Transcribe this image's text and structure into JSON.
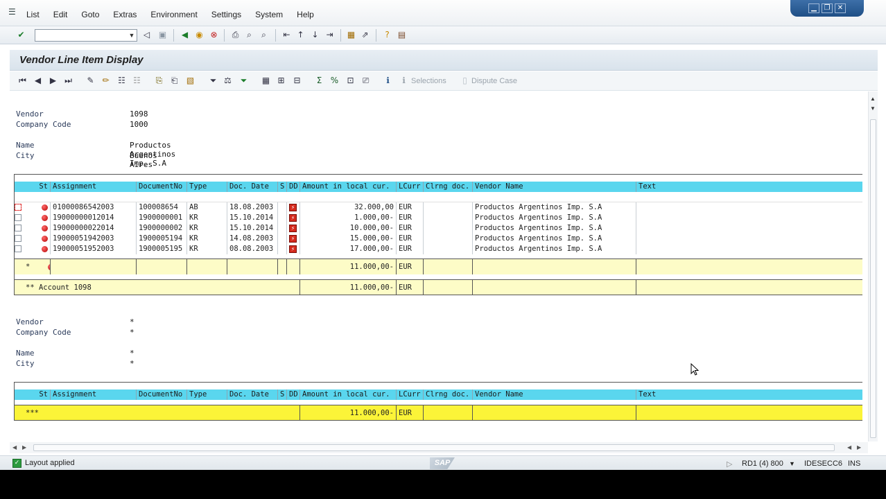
{
  "menu": [
    "List",
    "Edit",
    "Goto",
    "Extras",
    "Environment",
    "Settings",
    "System",
    "Help"
  ],
  "command_field": {
    "value": ""
  },
  "window_controls": {
    "minimize": "▁",
    "restore": "❐",
    "close": "✕"
  },
  "title": "Vendor Line Item Display",
  "app_toolbar": {
    "selections_label": "Selections",
    "dispute_label": "Dispute Case"
  },
  "header1": {
    "vendor_label": "Vendor",
    "vendor_value": "1098",
    "company_label": "Company Code",
    "company_value": "1000",
    "name_label": "Name",
    "name_value": "Productos Argentinos Imp. S.A",
    "city_label": "City",
    "city_value": "Buenos Aires"
  },
  "columns": [
    "St",
    "Assignment",
    "DocumentNo",
    "Type",
    "Doc. Date",
    "S",
    "DD",
    "Amount in local cur.",
    "LCurr",
    "Clrng doc.",
    "Vendor Name",
    "Text"
  ],
  "rows": [
    {
      "assignment": "01000086542003",
      "docno": "100008654",
      "type": "AB",
      "date": "18.08.2003",
      "amount": "32.000,00",
      "curr": "EUR",
      "vendor": "Productos Argentinos Imp. S.A"
    },
    {
      "assignment": "19000000012014",
      "docno": "1900000001",
      "type": "KR",
      "date": "15.10.2014",
      "amount": "1.000,00-",
      "curr": "EUR",
      "vendor": "Productos Argentinos Imp. S.A"
    },
    {
      "assignment": "19000000022014",
      "docno": "1900000002",
      "type": "KR",
      "date": "15.10.2014",
      "amount": "10.000,00-",
      "curr": "EUR",
      "vendor": "Productos Argentinos Imp. S.A"
    },
    {
      "assignment": "19000051942003",
      "docno": "1900005194",
      "type": "KR",
      "date": "14.08.2003",
      "amount": "15.000,00-",
      "curr": "EUR",
      "vendor": "Productos Argentinos Imp. S.A"
    },
    {
      "assignment": "19000051952003",
      "docno": "1900005195",
      "type": "KR",
      "date": "08.08.2003",
      "amount": "17.000,00-",
      "curr": "EUR",
      "vendor": "Productos Argentinos Imp. S.A"
    }
  ],
  "subtotal": {
    "marker": "*",
    "amount": "11.000,00-",
    "curr": "EUR"
  },
  "account_total": {
    "label": "** Account 1098",
    "amount": "11.000,00-",
    "curr": "EUR"
  },
  "header2": {
    "vendor_label": "Vendor",
    "vendor_value": "*",
    "company_label": "Company Code",
    "company_value": "*",
    "name_label": "Name",
    "name_value": "*",
    "city_label": "City",
    "city_value": "*"
  },
  "grand_total": {
    "marker": "***",
    "amount": "11.000,00-",
    "curr": "EUR"
  },
  "status": {
    "message": "Layout applied",
    "system": "RD1 (4) 800",
    "server": "IDESECC6",
    "mode": "INS",
    "logo": "SAP"
  },
  "colors": {
    "header_cyan": "#5ad6ee",
    "subtotal_yellow": "#fdfcc7",
    "total_yellow": "#fbf438"
  }
}
